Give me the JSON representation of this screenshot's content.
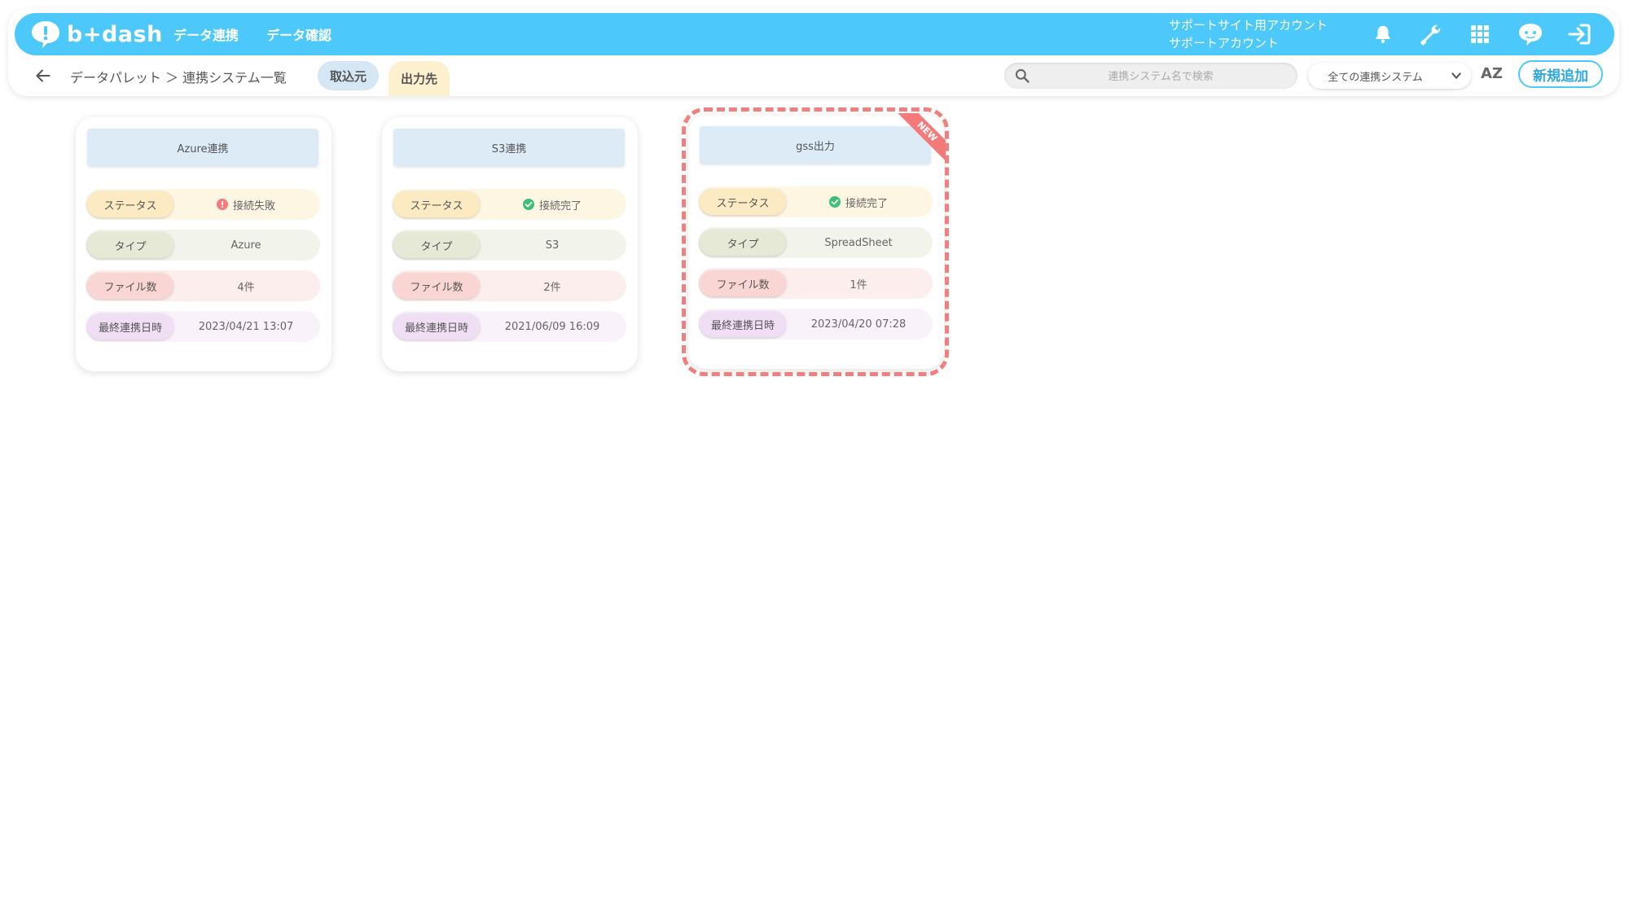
{
  "header": {
    "logo_text": "b+dash",
    "nav": [
      "データ連携",
      "データ確認"
    ],
    "account_line1": "サポートサイト用アカウント",
    "account_line2": "サポートアカウント",
    "icons": [
      "bell-icon",
      "wrench-icon",
      "apps-grid-icon",
      "chat-bot-icon",
      "logout-icon"
    ]
  },
  "subbar": {
    "breadcrumb": "データパレット ＞ 連携システム一覧",
    "tabs": [
      {
        "label": "取込元",
        "active": false
      },
      {
        "label": "出力先",
        "active": true
      }
    ],
    "search_placeholder": "連携システム名で検索",
    "filter_selected": "全ての連携システム",
    "sort_label": "AZ",
    "add_button": "新規追加"
  },
  "colors": {
    "brand": "#4cc9fa",
    "highlight": "#f08080",
    "status_ok": "#3dbf7a",
    "status_error": "#f47c7c"
  },
  "field_labels": {
    "status": "ステータス",
    "type": "タイプ",
    "files": "ファイル数",
    "last_sync": "最終連携日時"
  },
  "cards": [
    {
      "title": "Azure連携",
      "status": "接続失敗",
      "status_kind": "error",
      "type": "Azure",
      "files": "4件",
      "last_sync": "2023/04/21 13:07",
      "badge": ""
    },
    {
      "title": "S3連携",
      "status": "接続完了",
      "status_kind": "ok",
      "type": "S3",
      "files": "2件",
      "last_sync": "2021/06/09 16:09",
      "badge": ""
    },
    {
      "title": "gss出力",
      "status": "接続完了",
      "status_kind": "ok",
      "type": "SpreadSheet",
      "files": "1件",
      "last_sync": "2023/04/20 07:28",
      "badge": "NEW"
    }
  ]
}
